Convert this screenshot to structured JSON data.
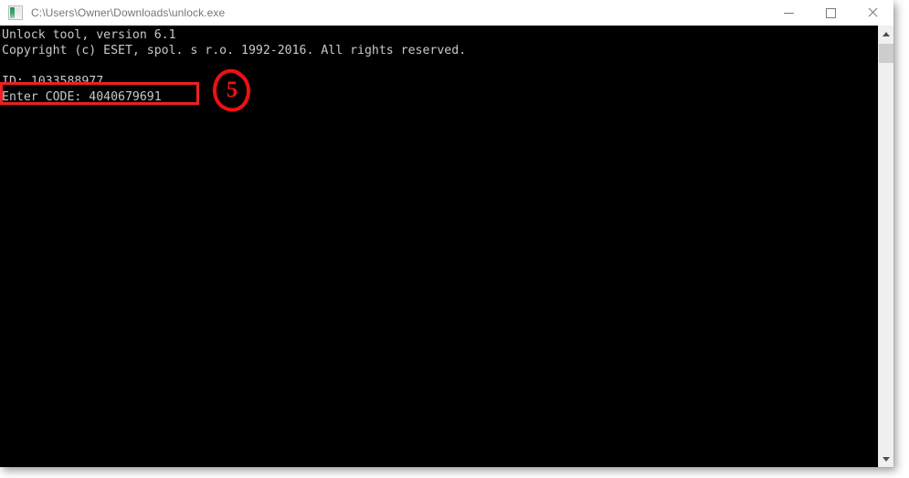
{
  "window": {
    "title": "C:\\Users\\Owner\\Downloads\\unlock.exe",
    "icon": "console-app-icon",
    "controls": {
      "minimize_label": "Minimize",
      "maximize_label": "Maximize",
      "close_label": "Close"
    }
  },
  "console": {
    "background_color": "#000000",
    "text_color": "#c8c8c8",
    "lines": [
      "Unlock tool, version 6.1",
      "Copyright (c) ESET, spol. s r.o. 1992-2016. All rights reserved.",
      "",
      "ID: 1033588977",
      "Enter CODE: 4040679691"
    ],
    "full_text": "Unlock tool, version 6.1\nCopyright (c) ESET, spol. s r.o. 1992-2016. All rights reserved.\n\nID: 1033588977\nEnter CODE: 4040679691",
    "fields": {
      "product_name": "Unlock tool",
      "version": "6.1",
      "copyright": "Copyright (c) ESET, spol. s r.o. 1992-2016. All rights reserved.",
      "id_label": "ID:",
      "id_value": "1033588977",
      "code_label": "Enter CODE:",
      "code_value": "4040679691"
    }
  },
  "scrollbar": {
    "up_arrow": "scroll-up-icon",
    "down_arrow": "scroll-down-icon",
    "thumb": "scrollbar-thumb"
  },
  "annotations": {
    "accent_color": "#ee2020",
    "step_number": "5",
    "highlight_target": "Enter CODE: 4040679691"
  }
}
